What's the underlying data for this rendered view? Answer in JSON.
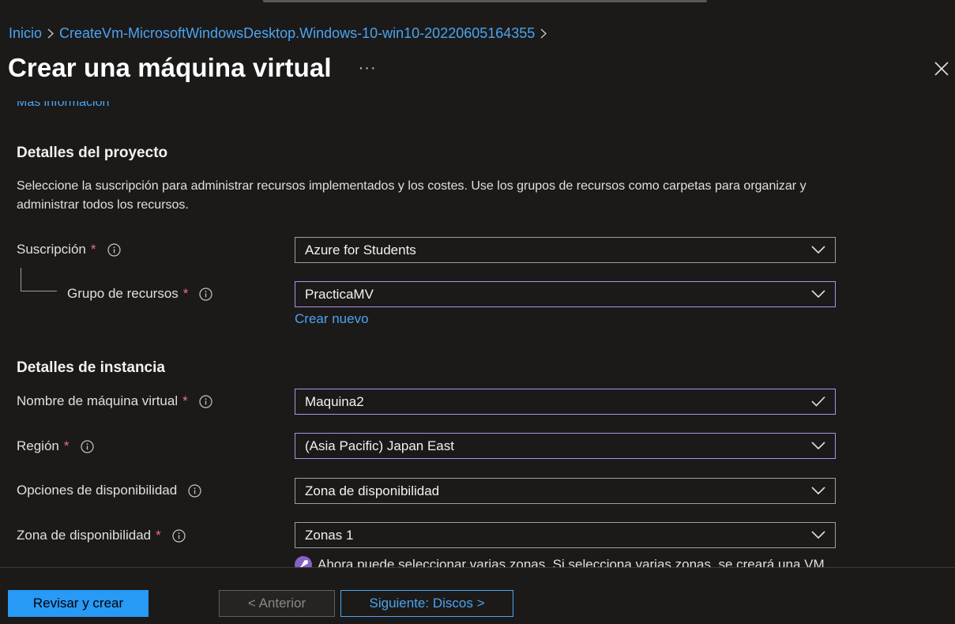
{
  "breadcrumb": {
    "home": "Inicio",
    "current": "CreateVm-MicrosoftWindowsDesktop.Windows-10-win10-20220605164355"
  },
  "header": {
    "title": "Crear una máquina virtual",
    "more": "···"
  },
  "content": {
    "more_info": "Más información",
    "project": {
      "title": "Detalles del proyecto",
      "description": "Seleccione la suscripción para administrar recursos implementados y los costes. Use los grupos de recursos como carpetas para organizar y administrar todos los recursos.",
      "subscription_label": "Suscripción",
      "subscription_value": "Azure for Students",
      "resource_group_label": "Grupo de recursos",
      "resource_group_value": "PracticaMV",
      "create_new": "Crear nuevo"
    },
    "instance": {
      "title": "Detalles de instancia",
      "vm_name_label": "Nombre de máquina virtual",
      "vm_name_value": "Maquina2",
      "region_label": "Región",
      "region_value": "(Asia Pacific) Japan East",
      "availability_options_label": "Opciones de disponibilidad",
      "availability_options_value": "Zona de disponibilidad",
      "availability_zone_label": "Zona de disponibilidad",
      "availability_zone_value": "Zonas 1",
      "notice": "Ahora puede seleccionar varias zonas. Si selecciona varias zonas, se creará una VM"
    },
    "required_mark": "*"
  },
  "footer": {
    "review_create": "Revisar y crear",
    "previous": "< Anterior",
    "next": "Siguiente: Discos >"
  },
  "colors": {
    "background": "#1b1a19",
    "link": "#4ca3f0",
    "primary_button": "#2899f5",
    "focus_border": "#b290e6",
    "required": "#f1707b"
  }
}
